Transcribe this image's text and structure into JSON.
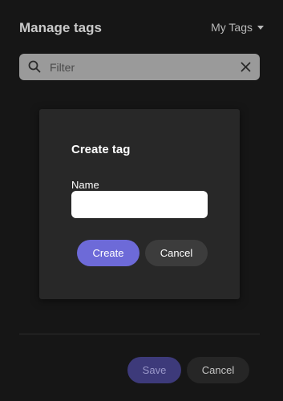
{
  "header": {
    "title": "Manage tags",
    "tags_dropdown_label": "My Tags"
  },
  "filter": {
    "placeholder": "Filter",
    "value": ""
  },
  "footer": {
    "save_label": "Save",
    "cancel_label": "Cancel"
  },
  "modal": {
    "title": "Create tag",
    "name_label": "Name",
    "name_value": "",
    "create_label": "Create",
    "cancel_label": "Cancel"
  },
  "icons": {
    "search": "search-icon",
    "clear": "close-icon",
    "dropdown": "chevron-down-icon"
  },
  "colors": {
    "accent": "#6d6ad8",
    "accent_disabled": "#3d3a7a",
    "background": "#161616",
    "modal_background": "#282828"
  }
}
